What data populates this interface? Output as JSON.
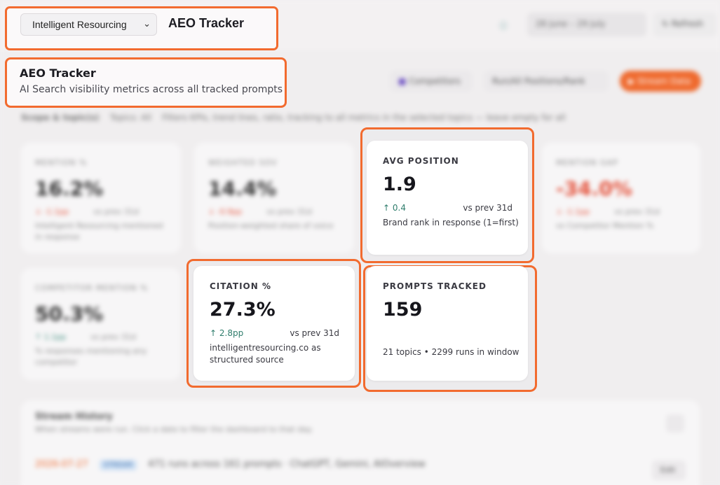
{
  "header": {
    "workspace_select": "Intelligent Resourcing",
    "app_title": "AEO Tracker",
    "date_range": "28 June – 29 July",
    "refresh_label": "Refresh"
  },
  "page": {
    "title": "AEO Tracker",
    "subtitle": "AI Search visibility metrics across all tracked prompts"
  },
  "toolbar": {
    "competitors_label": "Competitors",
    "nav_label": "Run/All Positions/Rank",
    "stream_label": "Stream Data"
  },
  "scope": {
    "label": "Scope & topic(s)",
    "topics": "Topics: All",
    "note": "Filters KPIs, trend lines, ratio, tracking to all metrics in the selected topics — leave empty for all"
  },
  "metrics": {
    "mention": {
      "label": "MENTION %",
      "value": "16.2%",
      "delta": "-1.1pp",
      "compare": "vs prev 31d",
      "desc": "Intelligent Resourcing mentioned in response"
    },
    "weighted": {
      "label": "WEIGHTED SOV",
      "value": "14.4%",
      "delta": "-0.9pp",
      "compare": "vs prev 31d",
      "desc": "Position-weighted share of voice"
    },
    "avg_position": {
      "label": "AVG POSITION",
      "value": "1.9",
      "delta": "0.4",
      "compare": "vs prev 31d",
      "desc": "Brand rank in response (1=first)"
    },
    "mention_gap": {
      "label": "MENTION GAP",
      "value": "-34.0%",
      "delta": "-1.1pp",
      "compare": "vs prev 31d",
      "desc": "vs Competitor Mention %"
    },
    "competitor_mention": {
      "label": "COMPETITOR MENTION %",
      "value": "50.3%",
      "delta": "1.1pp",
      "compare": "vs prev 31d",
      "desc": "% responses mentioning any competitor"
    },
    "citation": {
      "label": "CITATION %",
      "value": "27.3%",
      "delta": "2.8pp",
      "compare": "vs prev 31d",
      "desc": "intelligentresourcing.co as structured source"
    },
    "prompts_tracked": {
      "label": "PROMPTS TRACKED",
      "value": "159",
      "desc": "21 topics • 2299 runs in window"
    }
  },
  "stream_history": {
    "title": "Stream History",
    "subtitle": "When streams were run. Click a date to filter the dashboard to that day.",
    "row_date": "2026-07-27",
    "row_tag": "STREAM",
    "row_text": "471 runs across 161 prompts · ChatGPT, Gemini, AIOverview",
    "row_action": "Edit"
  },
  "colors": {
    "highlight": "#f26b2f",
    "positive": "#2f7d6c",
    "negative": "#e4513a"
  }
}
